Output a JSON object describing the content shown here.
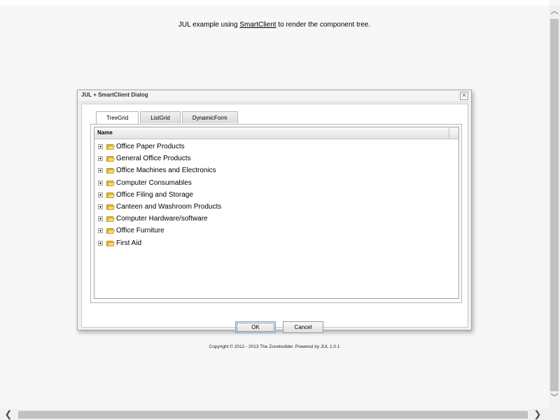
{
  "intro": {
    "prefix": "JUL example using ",
    "link": "SmartClient",
    "suffix": " to render the component tree."
  },
  "dialog": {
    "title": "JUL + SmartClient Dialog",
    "close_glyph": "✕",
    "tabs": [
      {
        "label": "TreeGrid",
        "active": true
      },
      {
        "label": "ListGrid",
        "active": false
      },
      {
        "label": "DynamicForm",
        "active": false
      }
    ],
    "grid": {
      "column_header": "Name",
      "rows": [
        "Office Paper Products",
        "General Office Products",
        "Office Machines and Electronics",
        "Computer Consumables",
        "Office Filing and Storage",
        "Canteen and Washroom Products",
        "Computer Hardware/software",
        "Office Furniture",
        "First Aid"
      ],
      "row_icon": "folder-icon",
      "expander_icon": "plus-expand-icon"
    },
    "buttons": {
      "ok": "OK",
      "cancel": "Cancel"
    }
  },
  "footer": {
    "copyright": "Copyright © 2012 - 2013 The Zonebuilder. Powered by JUL 1.0.1"
  },
  "scrollbars": {
    "up_glyph": "︿",
    "down_glyph": "﹀",
    "left_glyph": "❮",
    "right_glyph": "❯"
  },
  "colors": {
    "page_background": "#f7f7f7",
    "folder": "#e8c040"
  }
}
